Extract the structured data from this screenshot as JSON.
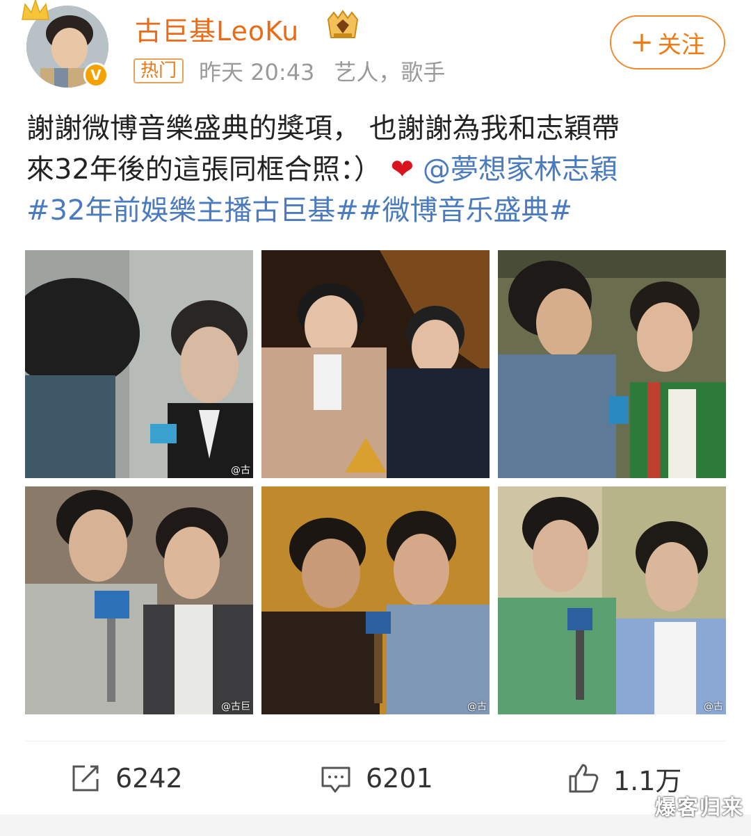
{
  "post": {
    "username": "古巨基LeoKu",
    "verified_badge": "V",
    "hot_tag": "热门",
    "time": "昨天 20:43",
    "user_tags": "艺人，歌手",
    "follow_label": "关注",
    "follow_plus": "+",
    "text_line1": "謝謝微博音樂盛典的獎項， 也謝謝為我和志穎帶",
    "text_line2": "來32年後的這張同框合照：）",
    "heart": "❤",
    "mention": "@夢想家林志穎",
    "topic1": "#32年前娛樂主播古巨基#",
    "topic2": "#微博音乐盛典#"
  },
  "photos": {
    "count": 6,
    "watermarks": [
      "@古",
      "",
      "",
      "@古巨",
      "@古",
      "@古"
    ]
  },
  "actions": {
    "repost_count": "6242",
    "comment_count": "6201",
    "like_count": "1.1万"
  },
  "watermark": "爆客归来",
  "colors": {
    "accent_orange": "#eb6a16",
    "link_blue": "#4a7bbf",
    "meta_gray": "#9a9a9a"
  },
  "icons": {
    "repost": "repost-icon",
    "comment": "comment-icon",
    "like": "thumbs-up-icon",
    "crown": "crown-icon",
    "vip": "vip-badge-icon"
  }
}
